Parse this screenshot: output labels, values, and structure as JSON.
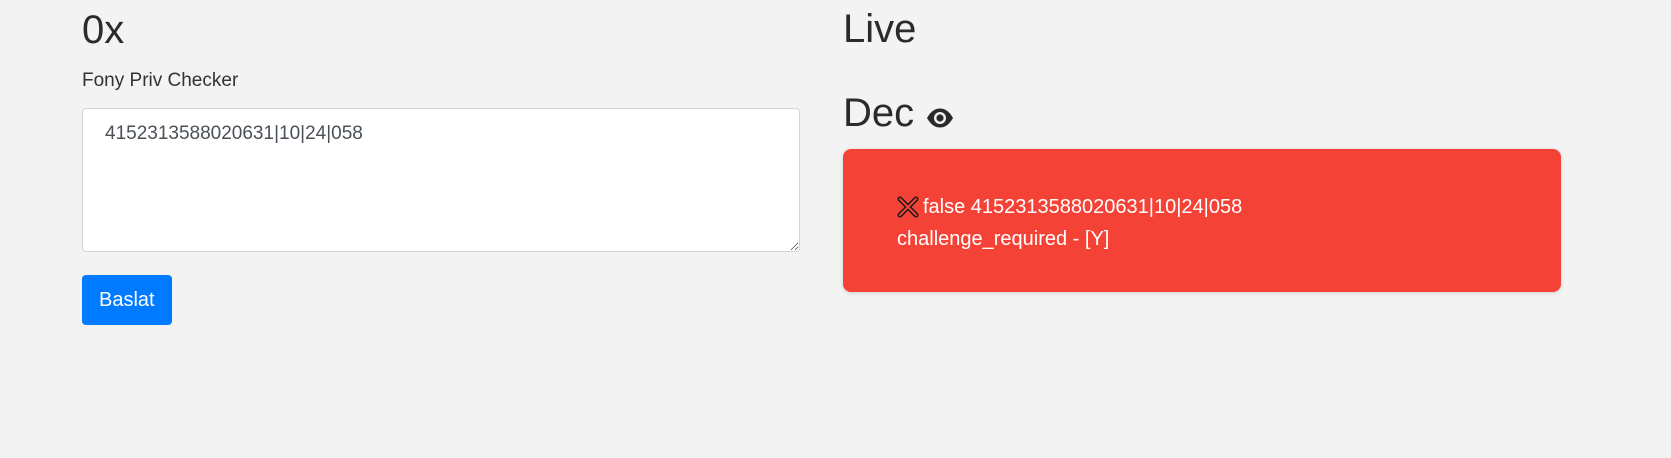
{
  "left": {
    "title": "0x",
    "subtitle": "Fony Priv Checker",
    "input_value": "4152313588020631|10|24|058",
    "start_button_label": "Baslat"
  },
  "right": {
    "live_title": "Live",
    "dec_title": "Dec",
    "dec_icon": "eye-icon",
    "result": {
      "status_icon": "cross-mark-icon",
      "line1": "false 4152313588020631|10|24|058",
      "line2": "challenge_required - [Y]",
      "background_color": "#f44336"
    }
  },
  "colors": {
    "page_background": "#f3f3f3",
    "button": "#007bff",
    "error_card": "#f44336"
  }
}
